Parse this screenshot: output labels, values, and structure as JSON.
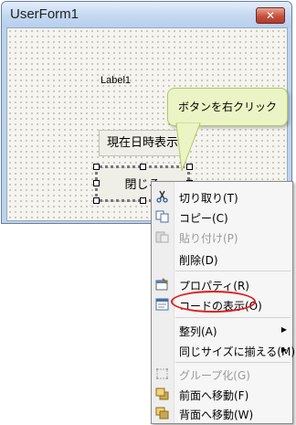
{
  "window": {
    "title": "UserForm1",
    "close_glyph": "✕"
  },
  "form": {
    "label1": "Label1",
    "button_now": "現在日時表示",
    "button_close": "閉じる"
  },
  "callout": {
    "text": "ボタンを右クリック"
  },
  "context_menu": {
    "items": [
      {
        "label": "切り取り(T)",
        "icon": "scissors-icon",
        "enabled": true
      },
      {
        "label": "コピー(C)",
        "icon": "copy-icon",
        "enabled": true
      },
      {
        "label": "貼り付け(P)",
        "icon": "paste-icon",
        "enabled": false
      },
      {
        "label": "削除(D)",
        "icon": "",
        "enabled": true
      },
      {
        "label": "プロパティ(R)",
        "icon": "properties-icon",
        "enabled": true
      },
      {
        "label": "コードの表示(O)",
        "icon": "view-code-icon",
        "enabled": true,
        "highlighted": true
      },
      {
        "label": "整列(A)",
        "icon": "",
        "enabled": true,
        "submenu": true
      },
      {
        "label": "同じサイズに揃える(M)",
        "icon": "",
        "enabled": true,
        "submenu": true
      },
      {
        "label": "グループ化(G)",
        "icon": "group-icon",
        "enabled": false
      },
      {
        "label": "前面へ移動(F)",
        "icon": "bring-to-front-icon",
        "enabled": true
      },
      {
        "label": "背面へ移動(W)",
        "icon": "send-to-back-icon",
        "enabled": true
      }
    ]
  },
  "colors": {
    "highlight_ellipse": "#e01b1b",
    "callout_bg": "#ebf4c4"
  }
}
